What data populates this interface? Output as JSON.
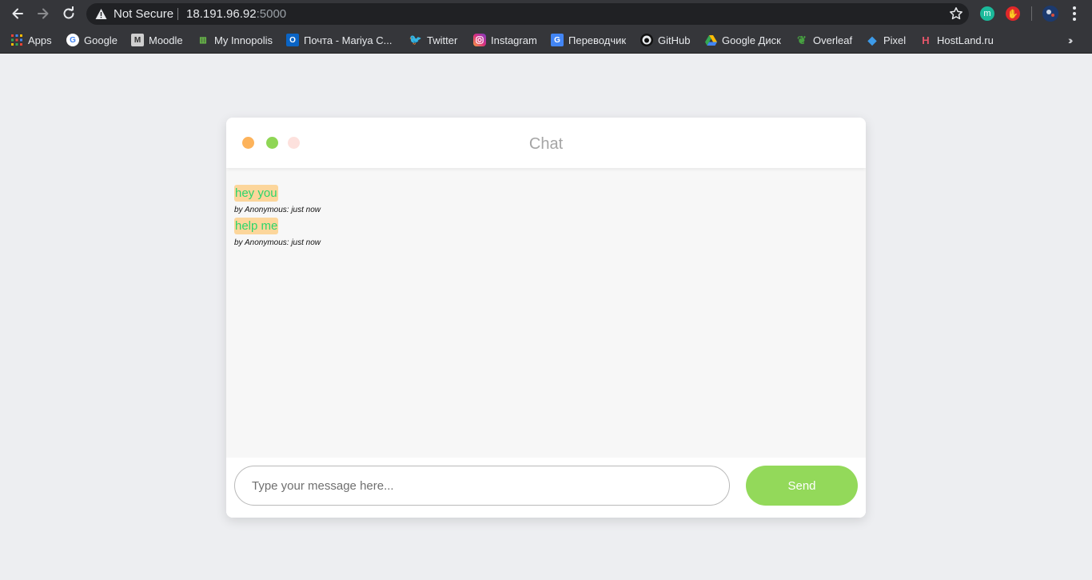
{
  "browser": {
    "security_label": "Not Secure",
    "url_host": "18.191.96.92",
    "url_port": ":5000",
    "extensions": [
      {
        "icon": "m-extension-icon",
        "letter": "m",
        "color": "#1bb99a"
      },
      {
        "icon": "adblock-icon",
        "letter": "✋",
        "color": "#e0282a"
      },
      {
        "icon": "profile-avatar-icon",
        "letter": "",
        "color": "#1c3a6e"
      }
    ]
  },
  "bookmarks": [
    {
      "label": "Apps",
      "icon": "apps-grid-icon"
    },
    {
      "label": "Google",
      "icon": "google-icon"
    },
    {
      "label": "Moodle",
      "icon": "moodle-icon"
    },
    {
      "label": "My Innopolis",
      "icon": "innopolis-icon"
    },
    {
      "label": "Почта - Mariya C...",
      "icon": "outlook-icon"
    },
    {
      "label": "Twitter",
      "icon": "twitter-icon"
    },
    {
      "label": "Instagram",
      "icon": "instagram-icon"
    },
    {
      "label": "Переводчик",
      "icon": "translate-icon"
    },
    {
      "label": "GitHub",
      "icon": "github-icon"
    },
    {
      "label": "Google Диск",
      "icon": "google-drive-icon"
    },
    {
      "label": "Overleaf",
      "icon": "overleaf-icon"
    },
    {
      "label": "Pixel",
      "icon": "pixel-icon"
    },
    {
      "label": "HostLand.ru",
      "icon": "hostland-icon"
    }
  ],
  "chat": {
    "title": "Chat",
    "window_dots": [
      "#fdb35b",
      "#8fd655",
      "#fde1dd"
    ],
    "messages": [
      {
        "text": "hey you",
        "meta": "by Anonymous: just now"
      },
      {
        "text": "help me",
        "meta": "by Anonymous: just now"
      }
    ],
    "input_placeholder": "Type your message here...",
    "send_label": "Send"
  },
  "colors": {
    "page_background": "#edeef1",
    "send_button": "#93d95a",
    "message_highlight": "#fcd69b",
    "message_text": "#2bd66b"
  }
}
